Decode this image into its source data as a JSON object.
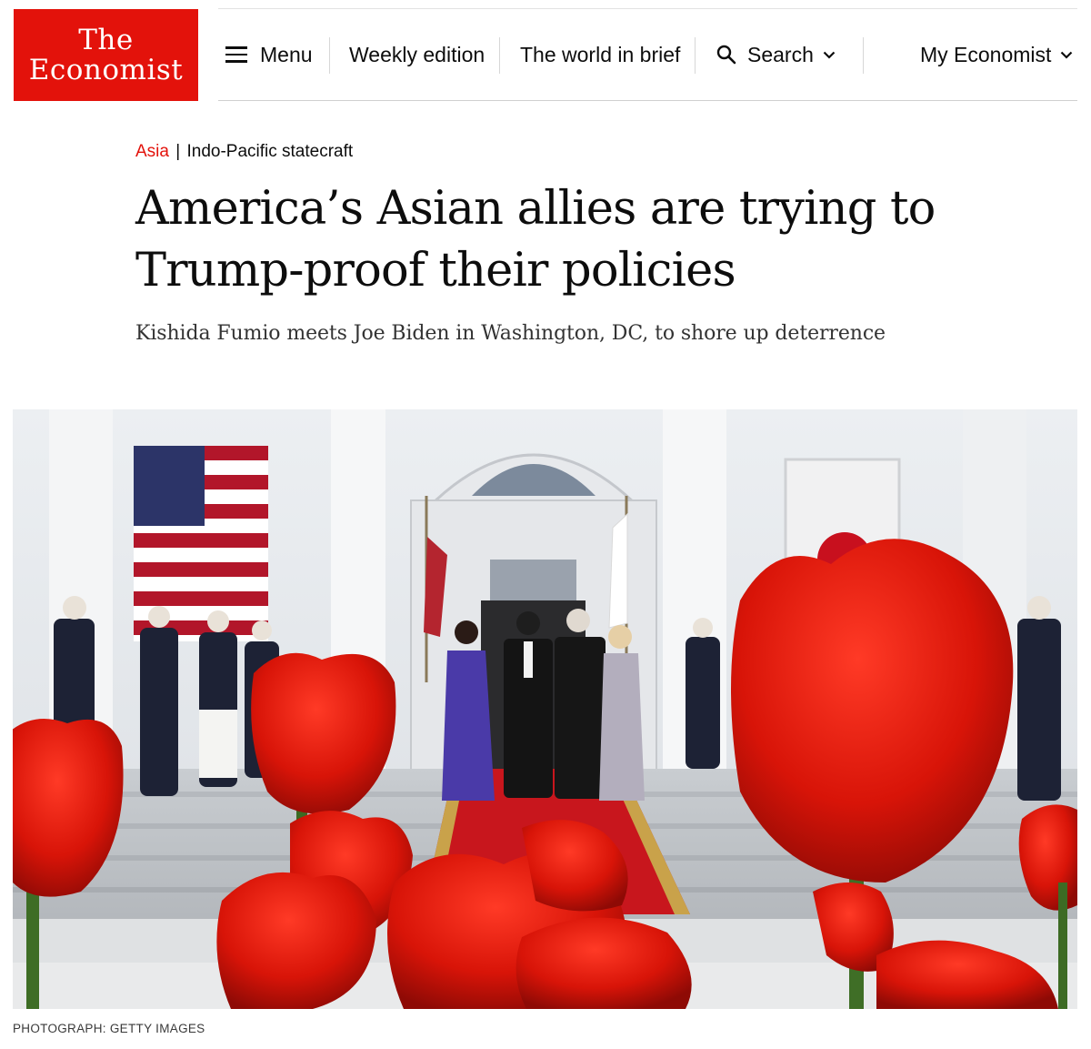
{
  "brand": {
    "line1": "The",
    "line2": "Economist",
    "color": "#e3120b"
  },
  "nav": {
    "menu_label": "Menu",
    "weekly_label": "Weekly edition",
    "brief_label": "The world in brief",
    "search_label": "Search",
    "account_label": "My Economist"
  },
  "icons": {
    "menu": "hamburger-icon",
    "search": "search-icon",
    "dropdown": "chevron-down-icon"
  },
  "article": {
    "section": "Asia",
    "separator": "|",
    "rubric": "Indo-Pacific statecraft",
    "headline": "America’s Asian allies are trying to Trump-proof their policies",
    "standfirst": "Kishida Fumio meets Joe Biden in Washington, DC, to shore up deterrence",
    "photo_credit": "PHOTOGRAPH: GETTY IMAGES"
  },
  "colors": {
    "accent": "#e3120b",
    "text": "#0d0d0d",
    "tulip": "#d41208",
    "carpet": "#c8161d"
  }
}
